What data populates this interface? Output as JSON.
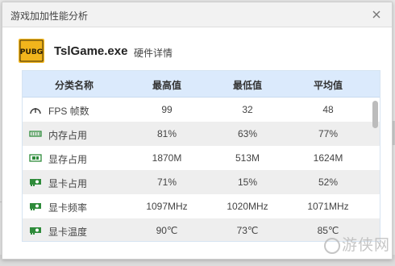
{
  "dialog": {
    "title": "游戏加加性能分析",
    "close_icon": "close-icon"
  },
  "app": {
    "logo_text": "PUBG",
    "name": "TslGame.exe",
    "subtitle": "硬件详情"
  },
  "table": {
    "headers": [
      "分类名称",
      "最高值",
      "最低值",
      "平均值"
    ],
    "rows": [
      {
        "icon": "gauge-icon",
        "name": "FPS 帧数",
        "max": "99",
        "min": "32",
        "avg": "48"
      },
      {
        "icon": "memory-icon",
        "name": "内存占用",
        "max": "81%",
        "min": "63%",
        "avg": "77%"
      },
      {
        "icon": "vram-icon",
        "name": "显存占用",
        "max": "1870M",
        "min": "513M",
        "avg": "1624M"
      },
      {
        "icon": "gpu-icon",
        "name": "显卡占用",
        "max": "71%",
        "min": "15%",
        "avg": "52%"
      },
      {
        "icon": "gpu-icon",
        "name": "显卡频率",
        "max": "1097MHz",
        "min": "1020MHz",
        "avg": "1071MHz"
      },
      {
        "icon": "gpu-icon",
        "name": "显卡温度",
        "max": "90℃",
        "min": "73℃",
        "avg": "85℃"
      }
    ]
  },
  "watermark": {
    "text": "游侠网"
  },
  "colors": {
    "header_bg": "#dbeafc",
    "row_alt_bg": "#eeeeee",
    "icon_green": "#2e8b3a",
    "logo_yellow": "#f2b51c"
  }
}
